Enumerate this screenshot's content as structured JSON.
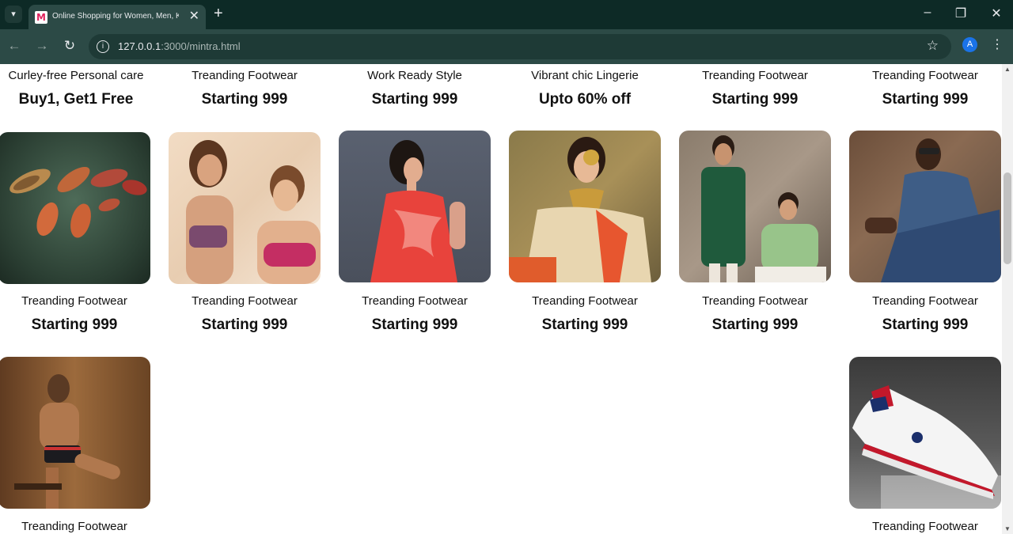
{
  "browser": {
    "tab_title": "Online Shopping for Women, Men, Kids",
    "favicon_letter": "M",
    "url_host": "127.0.0.1",
    "url_path": ":3000/mintra.html",
    "avatar_letter": "A"
  },
  "row1": [
    {
      "label": "Curley-free Personal care",
      "offer": "Buy1, Get1 Free"
    },
    {
      "label": "Treanding Footwear",
      "offer": "Starting 999"
    },
    {
      "label": "Work Ready Style",
      "offer": "Starting 999"
    },
    {
      "label": "Vibrant chic Lingerie",
      "offer": "Upto 60% off"
    },
    {
      "label": "Treanding Footwear",
      "offer": "Starting 999"
    },
    {
      "label": "Treanding Footwear",
      "offer": "Starting 999"
    }
  ],
  "row2": [
    {
      "label": "Treanding Footwear",
      "offer": "Starting 999",
      "image": "womens heels on green background"
    },
    {
      "label": "Treanding Footwear",
      "offer": "Starting 999",
      "image": "two women in lingerie"
    },
    {
      "label": "Treanding Footwear",
      "offer": "Starting 999",
      "image": "woman in red floral dress"
    },
    {
      "label": "Treanding Footwear",
      "offer": "Starting 999",
      "image": "woman in ethnic wear with jewelry"
    },
    {
      "label": "Treanding Footwear",
      "offer": "Starting 999",
      "image": "two men in kurtas"
    },
    {
      "label": "Treanding Footwear",
      "offer": "Starting 999",
      "image": "man in denim jacket"
    }
  ],
  "row3": [
    {
      "label": "Treanding Footwear",
      "image": "man in underwear"
    },
    {
      "label": "Treanding Footwear",
      "image": "white sneaker"
    }
  ]
}
